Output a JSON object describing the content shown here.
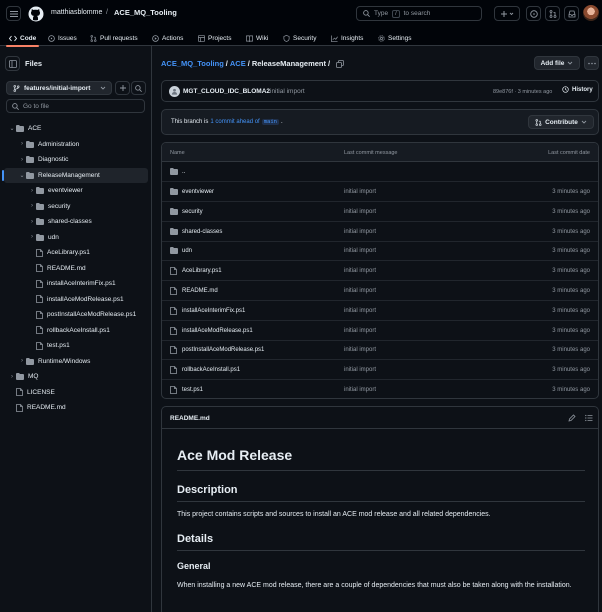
{
  "header": {
    "owner": "matthiasblomme",
    "separator": "/",
    "repo": "ACE_MQ_Tooling",
    "search_label": "Type",
    "search_key": "/",
    "search_suffix": "to search"
  },
  "nav_tabs": [
    {
      "label": "Code",
      "active": true
    },
    {
      "label": "Issues"
    },
    {
      "label": "Pull requests"
    },
    {
      "label": "Actions"
    },
    {
      "label": "Projects"
    },
    {
      "label": "Wiki"
    },
    {
      "label": "Security"
    },
    {
      "label": "Insights"
    },
    {
      "label": "Settings"
    }
  ],
  "sidebar": {
    "title": "Files",
    "branch": "features/initial-import",
    "goto_placeholder": "Go to file",
    "tree": [
      {
        "label": "ACE",
        "type": "folder",
        "depth": 0,
        "expanded": true
      },
      {
        "label": "Administration",
        "type": "folder",
        "depth": 1
      },
      {
        "label": "Diagnostic",
        "type": "folder",
        "depth": 1
      },
      {
        "label": "ReleaseManagement",
        "type": "folder",
        "depth": 1,
        "expanded": true,
        "selected": true
      },
      {
        "label": "eventviewer",
        "type": "folder",
        "depth": 2
      },
      {
        "label": "security",
        "type": "folder",
        "depth": 2
      },
      {
        "label": "shared-classes",
        "type": "folder",
        "depth": 2
      },
      {
        "label": "udn",
        "type": "folder",
        "depth": 2
      },
      {
        "label": "AceLibrary.ps1",
        "type": "file",
        "depth": 2
      },
      {
        "label": "README.md",
        "type": "file",
        "depth": 2
      },
      {
        "label": "installAceInterimFix.ps1",
        "type": "file",
        "depth": 2
      },
      {
        "label": "installAceModRelease.ps1",
        "type": "file",
        "depth": 2
      },
      {
        "label": "postInstallAceModRelease.ps1",
        "type": "file",
        "depth": 2
      },
      {
        "label": "rollbackAceInstall.ps1",
        "type": "file",
        "depth": 2
      },
      {
        "label": "test.ps1",
        "type": "file",
        "depth": 2
      },
      {
        "label": "Runtime/Windows",
        "type": "folder",
        "depth": 1
      },
      {
        "label": "MQ",
        "type": "folder",
        "depth": 0
      },
      {
        "label": "LICENSE",
        "type": "file",
        "depth": 0
      },
      {
        "label": "README.md",
        "type": "file",
        "depth": 0
      }
    ]
  },
  "breadcrumb": {
    "root": "ACE_MQ_Tooling",
    "sep1": "/",
    "part1": "ACE",
    "sep2": "/",
    "current": "ReleaseManagement",
    "sep3": "/"
  },
  "add_file_label": "Add file",
  "commit": {
    "author": "MGT_CLOUD_IDC_BLOMA2",
    "message": "initial import",
    "meta": "89e876f · 3 minutes ago",
    "history_label": "History"
  },
  "ahead": {
    "prefix": "This branch is",
    "link": "1 commit ahead of",
    "branch": "main",
    "suffix": ".",
    "contribute_label": "Contribute"
  },
  "table": {
    "col_name": "Name",
    "col_msg": "Last commit message",
    "col_date": "Last commit date",
    "parent": "..",
    "rows": [
      {
        "name": "eventviewer",
        "type": "folder",
        "msg": "initial import",
        "date": "3 minutes ago"
      },
      {
        "name": "security",
        "type": "folder",
        "msg": "initial import",
        "date": "3 minutes ago"
      },
      {
        "name": "shared-classes",
        "type": "folder",
        "msg": "initial import",
        "date": "3 minutes ago"
      },
      {
        "name": "udn",
        "type": "folder",
        "msg": "initial import",
        "date": "3 minutes ago"
      },
      {
        "name": "AceLibrary.ps1",
        "type": "file",
        "msg": "initial import",
        "date": "3 minutes ago"
      },
      {
        "name": "README.md",
        "type": "file",
        "msg": "initial import",
        "date": "3 minutes ago"
      },
      {
        "name": "installAceInterimFix.ps1",
        "type": "file",
        "msg": "initial import",
        "date": "3 minutes ago"
      },
      {
        "name": "installAceModRelease.ps1",
        "type": "file",
        "msg": "initial import",
        "date": "3 minutes ago"
      },
      {
        "name": "postInstallAceModRelease.ps1",
        "type": "file",
        "msg": "initial import",
        "date": "3 minutes ago"
      },
      {
        "name": "rollbackAceInstall.ps1",
        "type": "file",
        "msg": "initial import",
        "date": "3 minutes ago"
      },
      {
        "name": "test.ps1",
        "type": "file",
        "msg": "initial import",
        "date": "3 minutes ago"
      }
    ]
  },
  "readme": {
    "filename": "README.md",
    "h1": "Ace Mod Release",
    "h2_description": "Description",
    "p_description": "This project contains scripts and sources to install an ACE mod release and all related dependencies.",
    "h2_details": "Details",
    "h3_general": "General",
    "p_general": "When installing a new ACE mod release, there are a couple of dependencies that must also be taken along with the installation."
  },
  "colors": {
    "link": "#4493f8",
    "folder": "#9198a1",
    "accent_tab": "#f78166"
  }
}
